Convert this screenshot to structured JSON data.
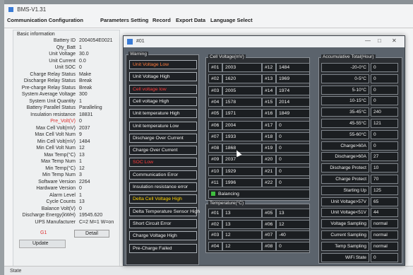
{
  "app": {
    "title": "BMS-V1.31"
  },
  "menu": [
    "Communication Configuration",
    "Parameters Setting",
    "Record",
    "Export Data",
    "Language Select"
  ],
  "basic_info": {
    "label": "Basic information",
    "rows": [
      {
        "k": "Battery ID",
        "v": "2004054E0021"
      },
      {
        "k": "Qty_Batt",
        "v": "1"
      },
      {
        "k": "Unit Voltage",
        "v": "30.0"
      },
      {
        "k": "Unit Current",
        "v": "0.0"
      },
      {
        "k": "Unit SOC",
        "v": "0"
      },
      {
        "k": "Charge Relay Status",
        "v": "Make"
      },
      {
        "k": "Discharge Relay Status",
        "v": "Break"
      },
      {
        "k": "Pre-charge Relay Status",
        "v": "Break"
      },
      {
        "k": "System Average Voltage",
        "v": "300"
      },
      {
        "k": "System Unit Quantity",
        "v": "1"
      },
      {
        "k": "Battery Parallel Status",
        "v": "Paralleling"
      },
      {
        "k": "Insulation resistance",
        "v": "18831"
      },
      {
        "k": "Pre_Volt(V)",
        "v": "0"
      },
      {
        "k": "Max Cell Volt(mV)",
        "v": "2037"
      },
      {
        "k": "Max Cell Volt Num",
        "v": "9"
      },
      {
        "k": "Min Cell Volt(mV)",
        "v": "1484"
      },
      {
        "k": "Min Cell Volt Num",
        "v": "12"
      },
      {
        "k": "Max Temp(°C)",
        "v": "13"
      },
      {
        "k": "Max Temp Num",
        "v": "1"
      },
      {
        "k": "Min Temp(°C)",
        "v": "12"
      },
      {
        "k": "Min Temp Num",
        "v": "3"
      },
      {
        "k": "Software Version",
        "v": "2264"
      },
      {
        "k": "Hardware Version",
        "v": "0"
      },
      {
        "k": "Alarm Level",
        "v": "1"
      },
      {
        "k": "Cycle Counts",
        "v": "13"
      },
      {
        "k": "Balance Volt(V)",
        "v": "0"
      },
      {
        "k": "Discharge Energy(kWH)",
        "v": "19545.620"
      },
      {
        "k": "UPS Manufacturer",
        "v": "C=2 M=1 W=on"
      }
    ],
    "g1": "G1",
    "detail_label": "Detail",
    "update_label": "Update"
  },
  "status": "State",
  "dialog": {
    "title": "#01",
    "warning": {
      "label": "Warning",
      "items": [
        {
          "text": "Unit Voltage Low",
          "color": "orange"
        },
        {
          "text": "Unit Voltage High",
          "color": "white"
        },
        {
          "text": "Cell voltage low",
          "color": "red"
        },
        {
          "text": "Cell voltage High",
          "color": "white"
        },
        {
          "text": "Unit temperature High",
          "color": "white"
        },
        {
          "text": "Unit temperature Low",
          "color": "white"
        },
        {
          "text": "Discharge Over Current",
          "color": "white"
        },
        {
          "text": "Charge Over Current",
          "color": "white"
        },
        {
          "text": "SOC Low",
          "color": "red"
        },
        {
          "text": "Communication Error",
          "color": "white"
        },
        {
          "text": "Insulation resistance error",
          "color": "white"
        },
        {
          "text": "Delta Cell Voltage High",
          "color": "yellow"
        },
        {
          "text": "Delta Temperature Sensor High",
          "color": "white"
        },
        {
          "text": "Short Circuit Error",
          "color": "white"
        },
        {
          "text": "Charge Voltage High",
          "color": "white"
        },
        {
          "text": "Pre-Charge Failed",
          "color": "white"
        }
      ]
    },
    "cell_voltage": {
      "label": "Cell Voltage(mV)",
      "rows": [
        [
          "#01",
          "2003",
          "#12",
          "1484"
        ],
        [
          "#02",
          "1620",
          "#13",
          "1969"
        ],
        [
          "#03",
          "2005",
          "#14",
          "1974"
        ],
        [
          "#04",
          "1578",
          "#15",
          "2014"
        ],
        [
          "#05",
          "1971",
          "#16",
          "1849"
        ],
        [
          "#06",
          "2004",
          "#17",
          "0"
        ],
        [
          "#07",
          "1933",
          "#18",
          "0"
        ],
        [
          "#08",
          "1868",
          "#19",
          "0"
        ],
        [
          "#09",
          "2037",
          "#20",
          "0"
        ],
        [
          "#10",
          "1929",
          "#21",
          "0"
        ],
        [
          "#11",
          "1996",
          "#22",
          "0"
        ]
      ],
      "balancing_label": "Balancing"
    },
    "temperature": {
      "label": "Temperature(°C)",
      "rows": [
        [
          "#01",
          "13",
          "#05",
          "13"
        ],
        [
          "#02",
          "13",
          "#06",
          "12"
        ],
        [
          "#03",
          "12",
          "#07",
          "-40"
        ],
        [
          "#04",
          "12",
          "#08",
          "0"
        ]
      ]
    },
    "accumulative": {
      "label": "Accumulative Total(Hour)",
      "rows": [
        {
          "k": "-20-0°C",
          "v": "0"
        },
        {
          "k": "0-5°C",
          "v": "0"
        },
        {
          "k": "5-10°C",
          "v": "0"
        },
        {
          "k": "10-15°C",
          "v": "0"
        },
        {
          "k": "35-45°C",
          "v": "240"
        },
        {
          "k": "45-55°C",
          "v": "121"
        },
        {
          "k": "55-60°C",
          "v": "0"
        },
        {
          "k": "Charge>60A",
          "v": "0"
        },
        {
          "k": "Discharge>60A",
          "v": "27"
        },
        {
          "k": "Discharge Protect",
          "v": "10"
        },
        {
          "k": "Charge Protect",
          "v": "70"
        },
        {
          "k": "Starting Up",
          "v": "125"
        },
        {
          "k": "Unit Voltage>57V",
          "v": "65"
        },
        {
          "k": "Unit Voltage<51V",
          "v": "44"
        },
        {
          "k": "Voltage Sampling",
          "v": "normal"
        },
        {
          "k": "Current Sampling",
          "v": "normal"
        },
        {
          "k": "Temp Sampling",
          "v": "normal"
        },
        {
          "k": "WiFi State",
          "v": "0"
        }
      ]
    }
  }
}
